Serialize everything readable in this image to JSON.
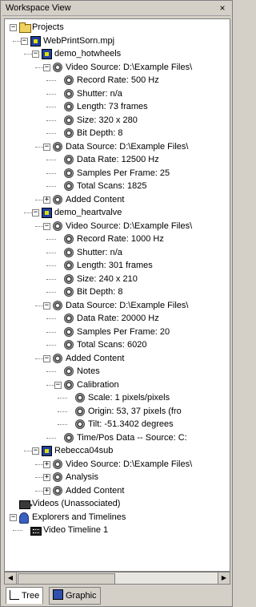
{
  "window": {
    "title": "Workspace View",
    "close_glyph": "×"
  },
  "tree": [
    {
      "id": "projects",
      "depth": 0,
      "expander": "−",
      "icon": "folder",
      "label": "Projects"
    },
    {
      "id": "webprintsorn",
      "depth": 1,
      "expander": "−",
      "icon": "project",
      "label": "WebPrintSorn.mpj"
    },
    {
      "id": "demo_hotwheels",
      "depth": 2,
      "expander": "−",
      "icon": "project",
      "label": "demo_hotwheels"
    },
    {
      "id": "hw_video",
      "depth": 3,
      "expander": "−",
      "icon": "gear",
      "label": "Video Source: D:\\Example Files\\"
    },
    {
      "id": "hw_rr",
      "depth": 4,
      "expander": "",
      "icon": "gear",
      "label": "Record Rate: 500 Hz"
    },
    {
      "id": "hw_sh",
      "depth": 4,
      "expander": "",
      "icon": "gear",
      "label": "Shutter: n/a"
    },
    {
      "id": "hw_len",
      "depth": 4,
      "expander": "",
      "icon": "gear",
      "label": "Length: 73 frames"
    },
    {
      "id": "hw_size",
      "depth": 4,
      "expander": "",
      "icon": "gear",
      "label": "Size: 320 x 280"
    },
    {
      "id": "hw_bd",
      "depth": 4,
      "expander": "",
      "icon": "gear",
      "label": "Bit Depth: 8"
    },
    {
      "id": "hw_data",
      "depth": 3,
      "expander": "−",
      "icon": "gear",
      "label": "Data Source: D:\\Example Files\\"
    },
    {
      "id": "hw_dr",
      "depth": 4,
      "expander": "",
      "icon": "gear",
      "label": "Data Rate: 12500 Hz"
    },
    {
      "id": "hw_spf",
      "depth": 4,
      "expander": "",
      "icon": "gear",
      "label": "Samples Per Frame: 25"
    },
    {
      "id": "hw_ts",
      "depth": 4,
      "expander": "",
      "icon": "gear",
      "label": "Total Scans: 1825"
    },
    {
      "id": "hw_added",
      "depth": 3,
      "expander": "+",
      "icon": "gear",
      "label": "Added Content"
    },
    {
      "id": "demo_heartvalve",
      "depth": 2,
      "expander": "−",
      "icon": "project",
      "label": "demo_heartvalve"
    },
    {
      "id": "hv_video",
      "depth": 3,
      "expander": "−",
      "icon": "gear",
      "label": "Video Source: D:\\Example Files\\"
    },
    {
      "id": "hv_rr",
      "depth": 4,
      "expander": "",
      "icon": "gear",
      "label": "Record Rate: 1000 Hz"
    },
    {
      "id": "hv_sh",
      "depth": 4,
      "expander": "",
      "icon": "gear",
      "label": "Shutter: n/a"
    },
    {
      "id": "hv_len",
      "depth": 4,
      "expander": "",
      "icon": "gear",
      "label": "Length: 301 frames"
    },
    {
      "id": "hv_size",
      "depth": 4,
      "expander": "",
      "icon": "gear",
      "label": "Size: 240 x 210"
    },
    {
      "id": "hv_bd",
      "depth": 4,
      "expander": "",
      "icon": "gear",
      "label": "Bit Depth: 8"
    },
    {
      "id": "hv_data",
      "depth": 3,
      "expander": "−",
      "icon": "gear",
      "label": "Data Source: D:\\Example Files\\"
    },
    {
      "id": "hv_dr",
      "depth": 4,
      "expander": "",
      "icon": "gear",
      "label": "Data Rate: 20000 Hz"
    },
    {
      "id": "hv_spf",
      "depth": 4,
      "expander": "",
      "icon": "gear",
      "label": "Samples Per Frame: 20"
    },
    {
      "id": "hv_ts",
      "depth": 4,
      "expander": "",
      "icon": "gear",
      "label": "Total Scans: 6020"
    },
    {
      "id": "hv_added",
      "depth": 3,
      "expander": "−",
      "icon": "gear",
      "label": "Added Content"
    },
    {
      "id": "hv_notes",
      "depth": 4,
      "expander": "",
      "icon": "gear",
      "label": "Notes"
    },
    {
      "id": "hv_cal",
      "depth": 4,
      "expander": "−",
      "icon": "gear",
      "label": "Calibration"
    },
    {
      "id": "hv_scale",
      "depth": 5,
      "expander": "",
      "icon": "gear",
      "label": "Scale: 1 pixels/pixels"
    },
    {
      "id": "hv_origin",
      "depth": 5,
      "expander": "",
      "icon": "gear",
      "label": "Origin: 53, 37 pixels (fro"
    },
    {
      "id": "hv_tilt",
      "depth": 5,
      "expander": "",
      "icon": "gear",
      "label": "Tilt: -51.3402 degrees"
    },
    {
      "id": "hv_tp",
      "depth": 4,
      "expander": "",
      "icon": "gear",
      "label": "Time/Pos Data -- Source: C:"
    },
    {
      "id": "rebecca",
      "depth": 2,
      "expander": "−",
      "icon": "project",
      "label": "Rebecca04sub"
    },
    {
      "id": "rb_video",
      "depth": 3,
      "expander": "+",
      "icon": "gear",
      "label": "Video Source: D:\\Example Files\\"
    },
    {
      "id": "rb_analysis",
      "depth": 3,
      "expander": "+",
      "icon": "gear",
      "label": "Analysis"
    },
    {
      "id": "rb_added",
      "depth": 3,
      "expander": "+",
      "icon": "gear",
      "label": "Added Content"
    },
    {
      "id": "videos",
      "depth": 0,
      "expander": "",
      "icon": "camera",
      "label": "Videos (Unassociated)"
    },
    {
      "id": "explorers",
      "depth": 0,
      "expander": "−",
      "icon": "explorer",
      "label": "Explorers and Timelines"
    },
    {
      "id": "timeline1",
      "depth": 1,
      "expander": "",
      "icon": "film",
      "label": "Video Timeline 1"
    }
  ],
  "tabs": [
    {
      "label": "Tree",
      "active": true
    },
    {
      "label": "Graphic",
      "active": false
    }
  ]
}
